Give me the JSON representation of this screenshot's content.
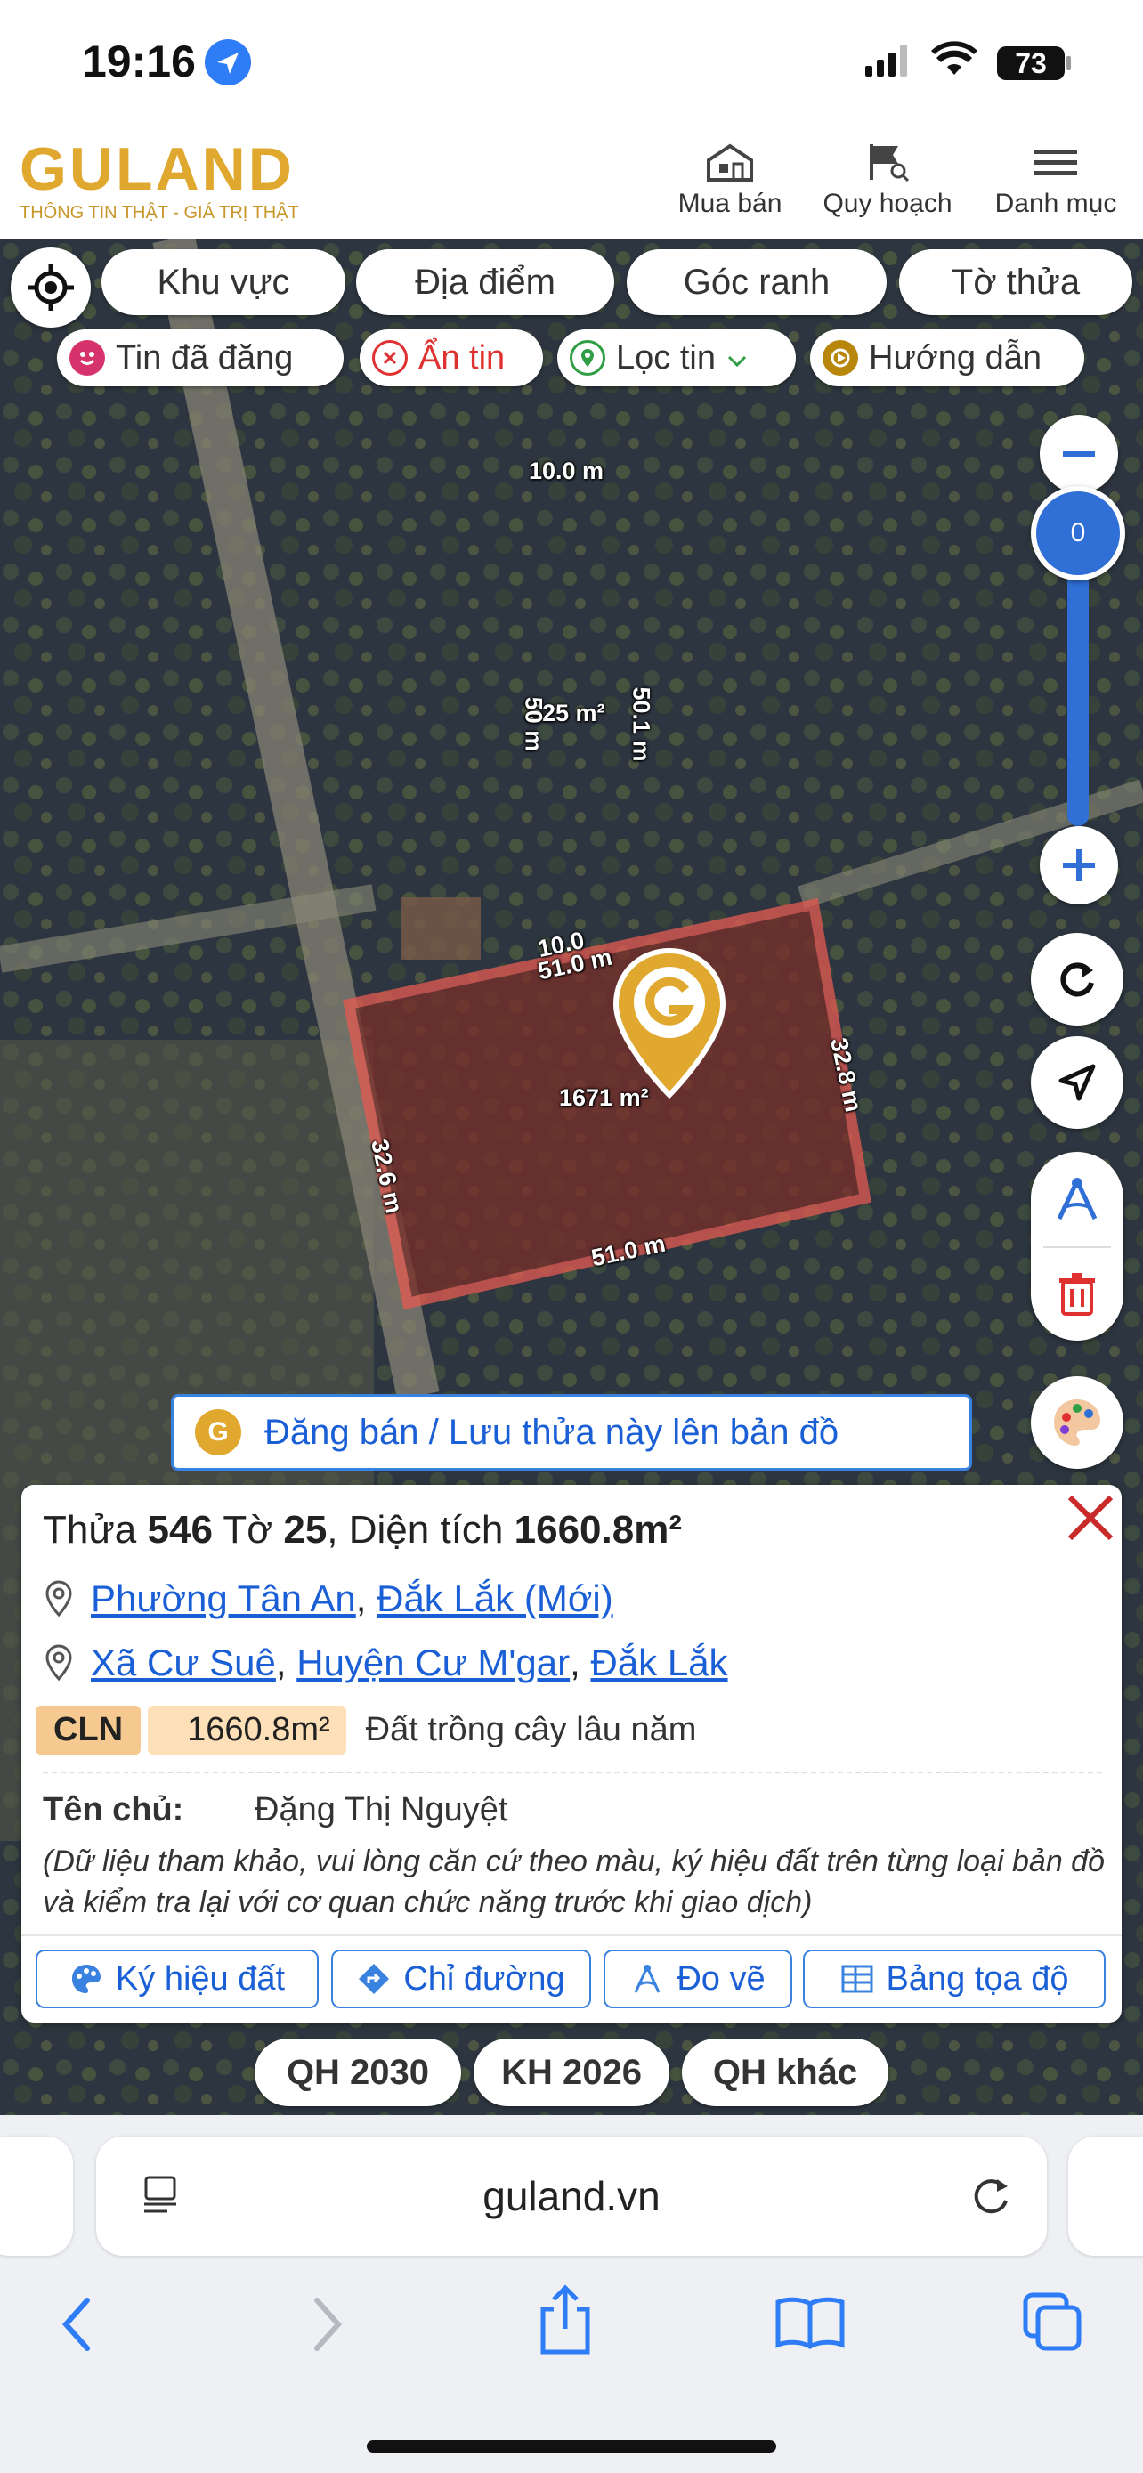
{
  "status_bar": {
    "time": "19:16",
    "battery": "73"
  },
  "header": {
    "logo_text": "GULAND",
    "logo_tagline": "THÔNG TIN THẬT - GIÁ TRỊ THẬT",
    "nav": [
      {
        "label": "Mua bán",
        "icon": "store-icon"
      },
      {
        "label": "Quy hoạch",
        "icon": "map-search-icon"
      },
      {
        "label": "Danh mục",
        "icon": "hamburger-menu-icon"
      }
    ]
  },
  "search_tabs": [
    "Khu vực",
    "Địa điểm",
    "Góc ranh",
    "Tờ thửa"
  ],
  "filter_chips": [
    {
      "label": "Tin đã đăng",
      "icon": "smile-icon",
      "color": "#d6336c"
    },
    {
      "label": "Ẩn tin",
      "icon": "close-circle-icon",
      "color": "#e03131"
    },
    {
      "label": "Lọc tin",
      "icon": "location-pin-icon",
      "color": "#2f9e44"
    },
    {
      "label": "Hướng dẫn",
      "icon": "guide-icon",
      "color": "#b8860b"
    }
  ],
  "zoom": {
    "level": "0",
    "fill_fraction": 0.85
  },
  "map_measurements": {
    "top_plot_width": "10.0 m",
    "top_plot_area": "525 m²",
    "top_plot_left_side": "50 m",
    "top_plot_right_side": "50.1 m",
    "selected_top_overlap": "10.0",
    "selected_top": "51.0 m",
    "selected_area": "1671 m²",
    "selected_right": "32.8 m",
    "selected_left": "32.6 m",
    "selected_bottom": "51.0 m"
  },
  "post_banner": "Đăng bán / Lưu thửa này lên bản đồ",
  "parcel": {
    "label_thua": "Thửa",
    "thua": "546",
    "label_to": "Tờ",
    "to": "25",
    "label_area": ", Diện tích",
    "area": "1660.8m²",
    "address_new": {
      "ward": "Phường Tân An",
      "province": "Đắk Lắk (Mới)"
    },
    "address_old": {
      "commune": "Xã Cư Suê",
      "district": "Huyện Cư M'gar",
      "province": "Đắk Lắk"
    },
    "land_code": "CLN",
    "land_area": "1660.8m²",
    "land_type": "Đất trồng cây lâu năm",
    "owner_label": "Tên chủ:",
    "owner_name": "Đặng Thị Nguyệt",
    "disclaimer": "(Dữ liệu tham khảo, vui lòng căn cứ theo màu, ký hiệu đất trên từng loại bản đồ và kiểm tra lại với cơ quan chức năng trước khi giao dịch)"
  },
  "actions": [
    "Ký hiệu đất",
    "Chỉ đường",
    "Đo vẽ",
    "Bảng tọa độ"
  ],
  "plan_buttons": [
    "QH 2030",
    "KH 2026",
    "QH khác"
  ],
  "browser": {
    "url": "guland.vn"
  },
  "colors": {
    "brand_gold": "#e0a82e",
    "link_blue": "#1a5fd6",
    "parcel_red": "#e55a52",
    "zoom_blue": "#2f6fd6"
  }
}
